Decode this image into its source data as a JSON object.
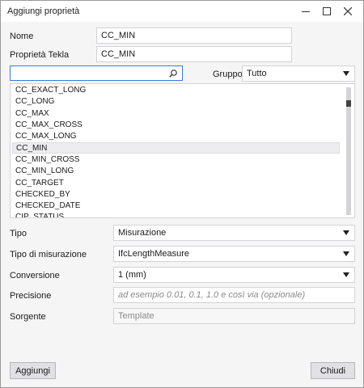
{
  "window": {
    "title": "Aggiungi proprietà"
  },
  "form": {
    "nome_label": "Nome",
    "nome_value": "CC_MIN",
    "tekla_label": "Proprietà Tekla",
    "tekla_value": "CC_MIN",
    "gruppo_label": "Gruppo",
    "gruppo_value": "Tutto",
    "search_value": ""
  },
  "property_list": {
    "items": [
      "CC_EXACT_LONG",
      "CC_LONG",
      "CC_MAX",
      "CC_MAX_CROSS",
      "CC_MAX_LONG",
      "CC_MIN",
      "CC_MIN_CROSS",
      "CC_MIN_LONG",
      "CC_TARGET",
      "CHECKED_BY",
      "CHECKED_DATE",
      "CIP_STATUS"
    ],
    "selected": "CC_MIN"
  },
  "details": {
    "tipo_label": "Tipo",
    "tipo_value": "Misurazione",
    "tipo_misurazione_label": "Tipo di misurazione",
    "tipo_misurazione_value": "IfcLengthMeasure",
    "conversione_label": "Conversione",
    "conversione_value": "1 (mm)",
    "precisione_label": "Precisione",
    "precisione_placeholder": "ad esempio 0.01, 0.1, 1.0 e così via (opzionale)",
    "sorgente_label": "Sorgente",
    "sorgente_value": "Template"
  },
  "buttons": {
    "add_label": "Aggiungi",
    "close_label": "Chiudi"
  },
  "icons": {
    "search": "search-icon",
    "minimize": "minimize-icon",
    "maximize": "maximize-icon",
    "close": "close-icon",
    "dropdown": "chevron-down-icon"
  }
}
